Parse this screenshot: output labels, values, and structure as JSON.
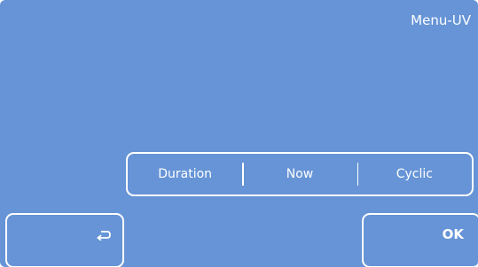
{
  "screen": {
    "title": "Menu-UV"
  },
  "options": [
    {
      "label": "Duration"
    },
    {
      "label": "Now"
    },
    {
      "label": "Cyclic"
    }
  ],
  "footer": {
    "back_icon": "return-arrow-icon",
    "ok_label": "OK"
  },
  "colors": {
    "background": "#6694d6",
    "foreground": "#ffffff"
  }
}
